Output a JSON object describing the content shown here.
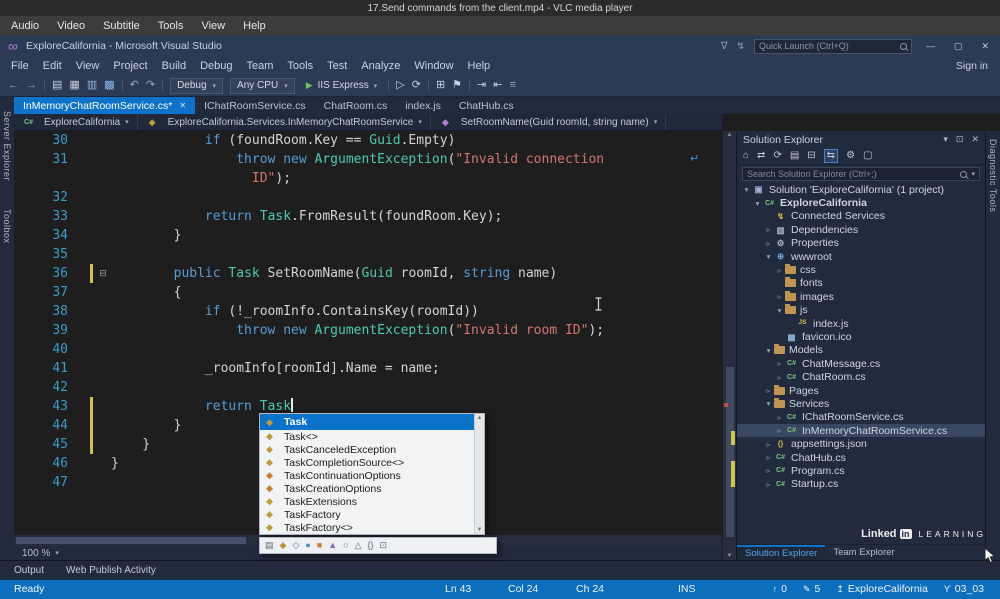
{
  "vlc": {
    "title": "17.Send commands from the client.mp4 - VLC media player",
    "menu": [
      "Audio",
      "Video",
      "Subtitle",
      "Tools",
      "View",
      "Help"
    ]
  },
  "vs": {
    "title": "ExploreCalifornia - Microsoft Visual Studio",
    "quick_launch_placeholder": "Quick Launch (Ctrl+Q)",
    "menu": [
      "File",
      "Edit",
      "View",
      "Project",
      "Build",
      "Debug",
      "Team",
      "Tools",
      "Test",
      "Analyze",
      "Window",
      "Help"
    ],
    "sign_in": "Sign in",
    "toolbar": {
      "left_icons": [
        {
          "n": "nav-back",
          "g": "←",
          "c": "#6da9e8"
        },
        {
          "n": "nav-forward",
          "g": "→",
          "c": "#6da9e8"
        },
        {
          "n": "separator"
        },
        {
          "n": "new-file",
          "g": "▤",
          "c": "#c8cedc"
        },
        {
          "n": "open-file",
          "g": "▦",
          "c": "#c8cedc"
        },
        {
          "n": "save",
          "g": "▥",
          "c": "#8fb7e8"
        },
        {
          "n": "save-all",
          "g": "▩",
          "c": "#8fb7e8"
        },
        {
          "n": "separator"
        },
        {
          "n": "undo",
          "g": "↶",
          "c": "#9aa4b8"
        },
        {
          "n": "redo",
          "g": "↷",
          "c": "#9aa4b8"
        },
        {
          "n": "separator"
        }
      ],
      "config_dropdown": "Debug",
      "platform_dropdown": "Any CPU",
      "run_label": "IIS Express",
      "right_icons": [
        {
          "n": "separator"
        },
        {
          "n": "attach",
          "g": "▷",
          "c": "#c8cedc"
        },
        {
          "n": "refresh",
          "g": "⟳",
          "c": "#c8cedc"
        },
        {
          "n": "separator"
        },
        {
          "n": "build",
          "g": "⊞",
          "c": "#c8cedc"
        },
        {
          "n": "bookmark-flag",
          "g": "⚑",
          "c": "#c8cedc"
        },
        {
          "n": "separator"
        },
        {
          "n": "indent",
          "g": "⇥",
          "c": "#c8cedc"
        },
        {
          "n": "outdent",
          "g": "⇤",
          "c": "#c8cedc"
        },
        {
          "n": "more-commands",
          "g": "≡",
          "c": "#9aa6bd"
        }
      ]
    },
    "doc_tabs": [
      {
        "label": "InMemoryChatRoomService.cs*",
        "active": true
      },
      {
        "label": "IChatRoomService.cs"
      },
      {
        "label": "ChatRoom.cs"
      },
      {
        "label": "index.js"
      },
      {
        "label": "ChatHub.cs"
      }
    ],
    "breadcrumb": [
      {
        "label": "ExploreCalifornia",
        "icon": "csproj"
      },
      {
        "label": "ExploreCalifornia.Services.InMemoryChatRoomService",
        "icon": "class"
      },
      {
        "label": "SetRoomName(Guid roomId, string name)",
        "icon": "method"
      }
    ],
    "left_tabs": [
      "Server Explorer",
      "Toolbox"
    ],
    "right_tab": "Diagnostic Tools",
    "editor": {
      "zoom": "100 %",
      "lines": [
        {
          "n": "30",
          "t": [
            [
              "p",
              "            "
            ],
            [
              "k",
              "if"
            ],
            [
              "p",
              " (foundRoom.Key == "
            ],
            [
              "t",
              "Guid"
            ],
            [
              "p",
              ".Empty)"
            ]
          ]
        },
        {
          "n": "31",
          "t": [
            [
              "p",
              "                "
            ],
            [
              "k",
              "throw"
            ],
            [
              "p",
              " "
            ],
            [
              "k",
              "new"
            ],
            [
              "p",
              " "
            ],
            [
              "t",
              "ArgumentException"
            ],
            [
              "p",
              "("
            ],
            [
              "s",
              "\"Invalid connection"
            ]
          ]
        },
        {
          "n": "",
          "t": [
            [
              "p",
              "                  "
            ],
            [
              "s",
              "ID\""
            ],
            [
              "p",
              ");"
            ]
          ]
        },
        {
          "n": "32",
          "t": []
        },
        {
          "n": "33",
          "t": [
            [
              "p",
              "            "
            ],
            [
              "k",
              "return"
            ],
            [
              "p",
              " "
            ],
            [
              "t",
              "Task"
            ],
            [
              "p",
              ".FromResult(foundRoom.Key);"
            ]
          ]
        },
        {
          "n": "34",
          "t": [
            [
              "p",
              "        }"
            ]
          ]
        },
        {
          "n": "35",
          "t": []
        },
        {
          "n": "36",
          "fold": "⊟",
          "chg": true,
          "t": [
            [
              "p",
              "        "
            ],
            [
              "k",
              "public"
            ],
            [
              "p",
              " "
            ],
            [
              "t",
              "Task"
            ],
            [
              "p",
              " SetRoomName("
            ],
            [
              "t",
              "Guid"
            ],
            [
              "p",
              " roomId, "
            ],
            [
              "k",
              "string"
            ],
            [
              "p",
              " name)"
            ]
          ]
        },
        {
          "n": "37",
          "t": [
            [
              "p",
              "        {"
            ]
          ]
        },
        {
          "n": "38",
          "t": [
            [
              "p",
              "            "
            ],
            [
              "k",
              "if"
            ],
            [
              "p",
              " (!_roomInfo.ContainsKey(roomId))"
            ]
          ]
        },
        {
          "n": "39",
          "t": [
            [
              "p",
              "                "
            ],
            [
              "k",
              "throw"
            ],
            [
              "p",
              " "
            ],
            [
              "k",
              "new"
            ],
            [
              "p",
              " "
            ],
            [
              "t",
              "ArgumentException"
            ],
            [
              "p",
              "("
            ],
            [
              "s",
              "\"Invalid room ID\""
            ],
            [
              "p",
              ");"
            ]
          ]
        },
        {
          "n": "40",
          "t": []
        },
        {
          "n": "41",
          "t": [
            [
              "p",
              "            _roomInfo[roomId].Name = name;"
            ]
          ]
        },
        {
          "n": "42",
          "t": []
        },
        {
          "n": "43",
          "chg": true,
          "caret": true,
          "t": [
            [
              "p",
              "            "
            ],
            [
              "k",
              "return"
            ],
            [
              "p",
              " "
            ],
            [
              "t",
              "Task"
            ]
          ]
        },
        {
          "n": "44",
          "chg": true,
          "t": [
            [
              "p",
              "        }"
            ]
          ]
        },
        {
          "n": "45",
          "chg": true,
          "t": [
            [
              "p",
              "    }"
            ]
          ]
        },
        {
          "n": "46",
          "t": [
            [
              "p",
              "}"
            ]
          ]
        },
        {
          "n": "47",
          "t": []
        }
      ]
    },
    "intellisense": {
      "selected": 0,
      "items": [
        {
          "label": "Task",
          "kind": "class"
        },
        {
          "label": "Task<>",
          "kind": "class"
        },
        {
          "label": "TaskCanceledException",
          "kind": "class"
        },
        {
          "label": "TaskCompletionSource<>",
          "kind": "class"
        },
        {
          "label": "TaskContinuationOptions",
          "kind": "enum"
        },
        {
          "label": "TaskCreationOptions",
          "kind": "enum"
        },
        {
          "label": "TaskExtensions",
          "kind": "class"
        },
        {
          "label": "TaskFactory",
          "kind": "class"
        },
        {
          "label": "TaskFactory<>",
          "kind": "class"
        }
      ],
      "filter_icons": [
        {
          "n": "filter-namespaces",
          "g": "▤",
          "c": "#5a6a7a"
        },
        {
          "n": "filter-classes",
          "g": "◆",
          "c": "#b8923e"
        },
        {
          "n": "filter-structs",
          "g": "◇",
          "c": "#4a7aa8"
        },
        {
          "n": "filter-interfaces",
          "g": "●",
          "c": "#4a90c8"
        },
        {
          "n": "filter-enums",
          "g": "■",
          "c": "#c87f35"
        },
        {
          "n": "filter-delegates",
          "g": "▲",
          "c": "#8a6ab0"
        },
        {
          "n": "filter-constants",
          "g": "○",
          "c": "#5a6a7a"
        },
        {
          "n": "filter-locals",
          "g": "△",
          "c": "#5a6a7a"
        },
        {
          "n": "filter-snippets",
          "g": "{}",
          "c": "#5a6a7a"
        },
        {
          "n": "filter-keywords",
          "g": "⊡",
          "c": "#5a6a7a"
        }
      ]
    },
    "solution_explorer": {
      "title": "Solution Explorer",
      "header_icons": [
        {
          "n": "window-position",
          "g": "▾"
        },
        {
          "n": "pin",
          "g": "⊡"
        },
        {
          "n": "close-panel",
          "g": "✕"
        }
      ],
      "toolbar_icons": [
        {
          "n": "home",
          "g": "⌂"
        },
        {
          "n": "switch-views",
          "g": "⇄"
        },
        {
          "n": "pending-changes-filter",
          "g": "⟳"
        },
        {
          "n": "show-all-files",
          "g": "▤"
        },
        {
          "n": "collapse-all",
          "g": "⊟"
        },
        {
          "n": "sync-with-active-document",
          "g": "⇆",
          "active": true
        },
        {
          "n": "properties",
          "g": "⚙"
        },
        {
          "n": "preview-selected",
          "g": "▢"
        }
      ],
      "search_placeholder": "Search Solution Explorer (Ctrl+;)",
      "tree": [
        {
          "ind": 0,
          "exp": "o",
          "ic": "sln",
          "label": "Solution 'ExploreCalifornia' (1 project)"
        },
        {
          "ind": 1,
          "exp": "o",
          "ic": "csproj",
          "label": "ExploreCalifornia",
          "bold": true
        },
        {
          "ind": 2,
          "exp": "",
          "ic": "plug",
          "label": "Connected Services"
        },
        {
          "ind": 2,
          "exp": "c",
          "ic": "dep",
          "label": "Dependencies"
        },
        {
          "ind": 2,
          "exp": "c",
          "ic": "prop",
          "label": "Properties"
        },
        {
          "ind": 2,
          "exp": "o",
          "ic": "www",
          "label": "wwwroot"
        },
        {
          "ind": 3,
          "exp": "c",
          "ic": "folder",
          "label": "css"
        },
        {
          "ind": 3,
          "ex p": "c",
          "ic": "folder",
          "label": "fonts"
        },
        {
          "ind": 3,
          "exp": "c",
          "ic": "folder",
          "label": "images"
        },
        {
          "ind": 3,
          "exp": "o",
          "ic": "folder",
          "label": "js"
        },
        {
          "ind": 4,
          "exp": "",
          "ic": "js",
          "label": "index.js"
        },
        {
          "ind": 3,
          "exp": "",
          "ic": "img",
          "label": "favicon.ico"
        },
        {
          "ind": 2,
          "exp": "o",
          "ic": "folder",
          "label": "Models"
        },
        {
          "ind": 3,
          "exp": "c",
          "ic": "cs",
          "label": "ChatMessage.cs"
        },
        {
          "ind": 3,
          "exp": "c",
          "ic": "cs",
          "label": "ChatRoom.cs"
        },
        {
          "ind": 2,
          "exp": "c",
          "ic": "folder",
          "label": "Pages"
        },
        {
          "ind": 2,
          "exp": "o",
          "ic": "folder",
          "label": "Services"
        },
        {
          "ind": 3,
          "exp": "c",
          "ic": "cs",
          "label": "IChatRoomService.cs"
        },
        {
          "ind": 3,
          "exp": "c",
          "ic": "cs",
          "label": "InMemoryChatRoomService.cs",
          "sel": true
        },
        {
          "ind": 2,
          "exp": "c",
          "ic": "json",
          "label": "appsettings.json"
        },
        {
          "ind": 2,
          "exp": "c",
          "ic": "cs",
          "label": "ChatHub.cs"
        },
        {
          "ind": 2,
          "exp": "c",
          "ic": "cs",
          "label": "Program.cs"
        },
        {
          "ind": 2,
          "exp": "c",
          "ic": "cs",
          "label": "Startup.cs"
        }
      ],
      "bottom_tabs": [
        {
          "label": "Solution Explorer",
          "active": true
        },
        {
          "label": "Team Explorer"
        }
      ]
    },
    "output_tabs": [
      "Output",
      "Web Publish Activity"
    ],
    "status": {
      "ready": "Ready",
      "ln": "Ln 43",
      "col": "Col 24",
      "ch": "Ch 24",
      "ins": "INS",
      "git": [
        {
          "n": "commits-to-push",
          "g": "↑",
          "v": "0"
        },
        {
          "n": "pending-edits",
          "g": "✎",
          "v": "5"
        },
        {
          "n": "repository",
          "g": "↥",
          "v": "ExploreCalifornia"
        },
        {
          "n": "branch",
          "g": "ϒ",
          "v": "03_03"
        }
      ]
    }
  },
  "watermark": {
    "linked": "Linked",
    "in": "in",
    "learning": "LEARNING"
  },
  "icon_glyphs": {
    "sln": {
      "g": "▣",
      "c": "#9fb0d0"
    },
    "csproj": {
      "g": "C#",
      "c": "#7cc47c",
      "fs": 7
    },
    "plug": {
      "g": "↯",
      "c": "#d2b84c"
    },
    "dep": {
      "g": "▥",
      "c": "#aab4c4"
    },
    "prop": {
      "g": "⚙",
      "c": "#aab4c4"
    },
    "www": {
      "g": "⊕",
      "c": "#6fa8dc"
    },
    "js": {
      "g": "JS",
      "c": "#d8c44a",
      "fs": 6.5
    },
    "img": {
      "g": "▦",
      "c": "#8cb4d8"
    },
    "cs": {
      "g": "C#",
      "c": "#7cc47c",
      "fs": 7
    },
    "json": {
      "g": "{}",
      "c": "#d8c44a",
      "fs": 7
    },
    "class": {
      "g": "◆",
      "c": "#c09a3e"
    },
    "enum": {
      "g": "◆",
      "c": "#c87f35"
    },
    "method": {
      "g": "◆",
      "c": "#b180d7"
    }
  }
}
